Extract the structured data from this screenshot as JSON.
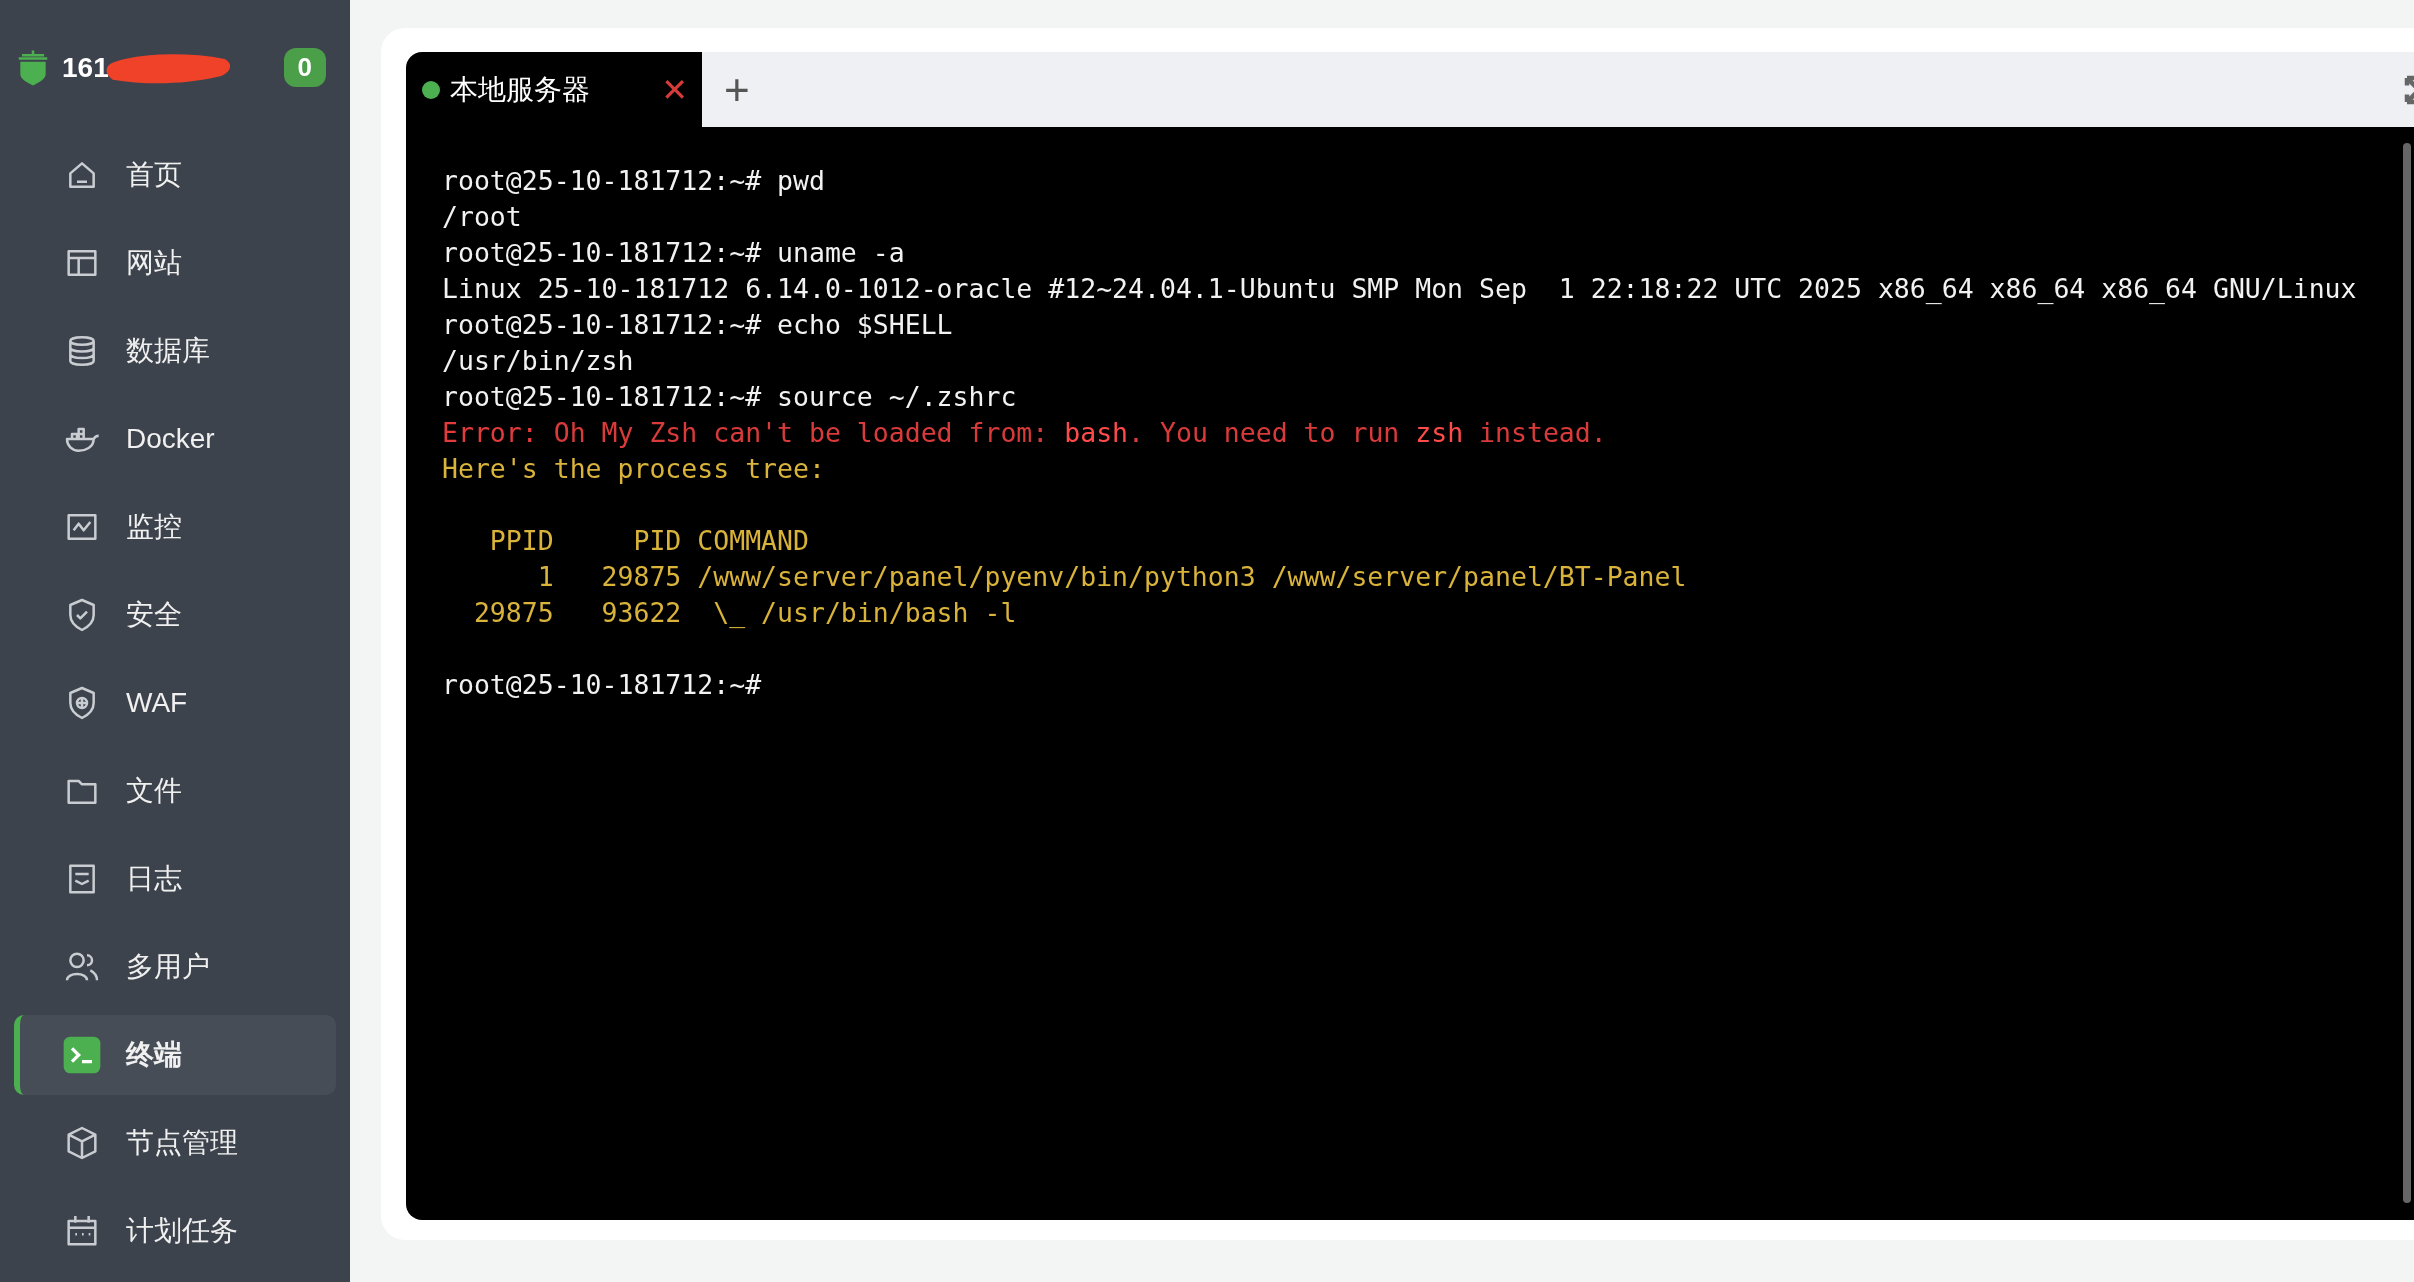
{
  "sidebar": {
    "host": "161",
    "notification_count": "0",
    "items": [
      {
        "label": "首页",
        "selected": false
      },
      {
        "label": "网站",
        "selected": false
      },
      {
        "label": "数据库",
        "selected": false
      },
      {
        "label": "Docker",
        "selected": false
      },
      {
        "label": "监控",
        "selected": false
      },
      {
        "label": "安全",
        "selected": false
      },
      {
        "label": "WAF",
        "selected": false
      },
      {
        "label": "文件",
        "selected": false
      },
      {
        "label": "日志",
        "selected": false
      },
      {
        "label": "多用户",
        "selected": false
      },
      {
        "label": "终端",
        "selected": true
      },
      {
        "label": "节点管理",
        "selected": false
      },
      {
        "label": "计划任务",
        "selected": false
      }
    ]
  },
  "tabs": [
    {
      "label": "本地服务器",
      "selected": true,
      "connected": true,
      "close": "✕"
    }
  ],
  "add_tab": "+",
  "terminal": {
    "lines": [
      [
        {
          "text": "root@25-10-181712:~# pwd",
          "color": "#f2f2f2"
        }
      ],
      [
        {
          "text": "/root",
          "color": "#f2f2f2"
        }
      ],
      [
        {
          "text": "root@25-10-181712:~# uname -a",
          "color": "#f2f2f2"
        }
      ],
      [
        {
          "text": "Linux 25-10-181712 6.14.0-1012-oracle #12~24.04.1-Ubuntu SMP Mon Sep  1 22:18:22 UTC 2025 x86_64 x86_64 x86_64 GNU/Linux",
          "color": "#f2f2f2"
        }
      ],
      [
        {
          "text": "root@25-10-181712:~# echo $SHELL",
          "color": "#f2f2f2"
        }
      ],
      [
        {
          "text": "/usr/bin/zsh",
          "color": "#f2f2f2"
        }
      ],
      [
        {
          "text": "root@25-10-181712:~# source ~/.zshrc",
          "color": "#f2f2f2"
        }
      ],
      [
        {
          "text": "Error:",
          "color": "#e23b3b"
        },
        {
          "text": " Oh My Zsh can't be loaded from: ",
          "color": "#d93a3a"
        },
        {
          "text": "bash",
          "color": "#ff4a4a"
        },
        {
          "text": ". You need to run ",
          "color": "#d93a3a"
        },
        {
          "text": "zsh",
          "color": "#ff4a4a"
        },
        {
          "text": " instead.",
          "color": "#d93a3a"
        }
      ],
      [
        {
          "text": "Here's the process tree:",
          "color": "#d9b33a"
        }
      ],
      {
        "kind": "blank"
      },
      [
        {
          "text": "   PPID     PID COMMAND",
          "color": "#d9b33a"
        }
      ],
      [
        {
          "text": "      1   29875 /www/server/panel/pyenv/bin/python3 /www/server/panel/BT-Panel",
          "color": "#d9b33a"
        }
      ],
      [
        {
          "text": "  29875   93622  \\_ /usr/bin/bash -l",
          "color": "#d9b33a"
        }
      ],
      {
        "kind": "blank"
      },
      [
        {
          "text": "root@25-10-181712:~#",
          "color": "#f2f2f2"
        }
      ]
    ]
  }
}
